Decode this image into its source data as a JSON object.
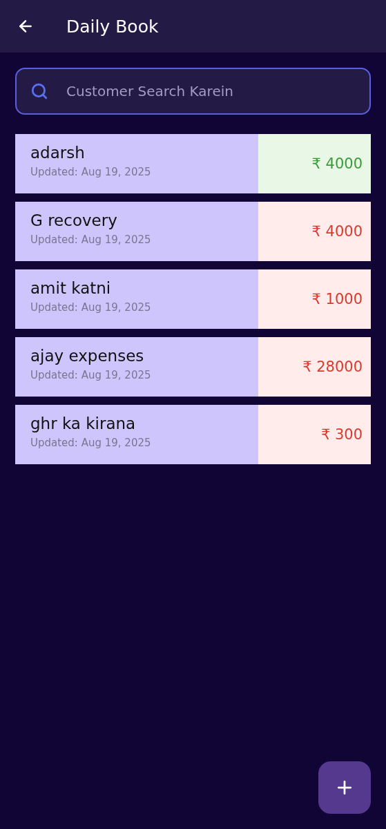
{
  "header": {
    "title": "Daily Book"
  },
  "search": {
    "placeholder": "Customer Search Karein"
  },
  "customers": [
    {
      "name": "adarsh",
      "updated": "Updated: Aug 19, 2025",
      "amount": "₹ 4000",
      "kind": "credit"
    },
    {
      "name": "G recovery",
      "updated": "Updated: Aug 19, 2025",
      "amount": "₹ 4000",
      "kind": "debit"
    },
    {
      "name": "amit katni",
      "updated": "Updated: Aug 19, 2025",
      "amount": "₹ 1000",
      "kind": "debit"
    },
    {
      "name": "ajay expenses",
      "updated": "Updated: Aug 19, 2025",
      "amount": "₹ 28000",
      "kind": "debit"
    },
    {
      "name": "ghr ka kirana",
      "updated": "Updated: Aug 19, 2025",
      "amount": "₹ 300",
      "kind": "debit"
    }
  ]
}
